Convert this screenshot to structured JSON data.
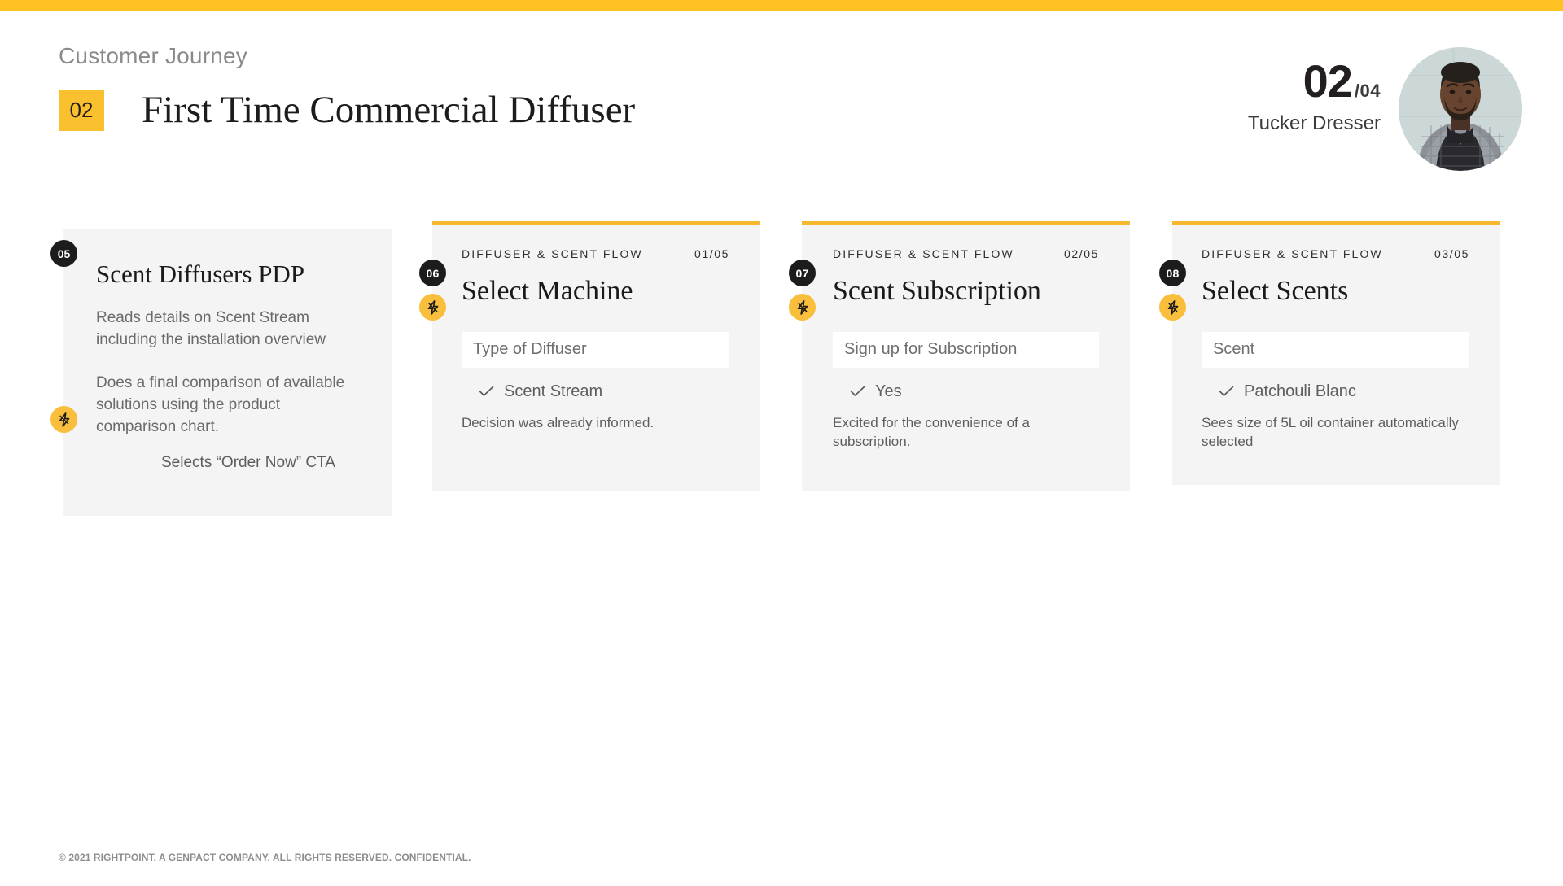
{
  "theme": {
    "accent": "#FFC222",
    "accent_soft": "#F9BE3B",
    "card_bg": "#F4F4F4",
    "badge_dark": "#1C1C1C"
  },
  "header": {
    "eyebrow": "Customer Journey",
    "section_number": "02",
    "title": "First Time Commercial Diffuser",
    "pager_current": "02",
    "pager_total": "/04",
    "persona_name": "Tucker Dresser"
  },
  "cards": [
    {
      "step": "05",
      "has_accent_bar": false,
      "meta_label": "",
      "meta_count": "",
      "title": "Scent Diffusers PDP",
      "paragraphs": [
        "Reads details on Scent Stream including the installation overview",
        "Does a final comparison of available solutions using the product comparison chart."
      ],
      "cta": "Selects “Order Now” CTA",
      "bolt": "lightning-icon"
    },
    {
      "step": "06",
      "has_accent_bar": true,
      "meta_label": "DIFFUSER & SCENT FLOW",
      "meta_count": "01/05",
      "title": "Select Machine",
      "field_value": "Type of Diffuser",
      "check_label": "Scent Stream",
      "note": "Decision was already informed.",
      "bolt": "lightning-icon"
    },
    {
      "step": "07",
      "has_accent_bar": true,
      "meta_label": "DIFFUSER & SCENT FLOW",
      "meta_count": "02/05",
      "title": "Scent Subscription",
      "field_value": "Sign up for Subscription",
      "check_label": "Yes",
      "note": "Excited for the convenience of a subscription.",
      "bolt": "lightning-icon"
    },
    {
      "step": "08",
      "has_accent_bar": true,
      "meta_label": "DIFFUSER & SCENT FLOW",
      "meta_count": "03/05",
      "title": "Select Scents",
      "field_value": "Scent",
      "check_label": "Patchouli Blanc",
      "note": "Sees size of 5L oil container automatically selected",
      "bolt": "lightning-icon"
    }
  ],
  "footer": {
    "copyright": "© 2021 RIGHTPOINT, A GENPACT COMPANY. ALL RIGHTS RESERVED. CONFIDENTIAL."
  }
}
